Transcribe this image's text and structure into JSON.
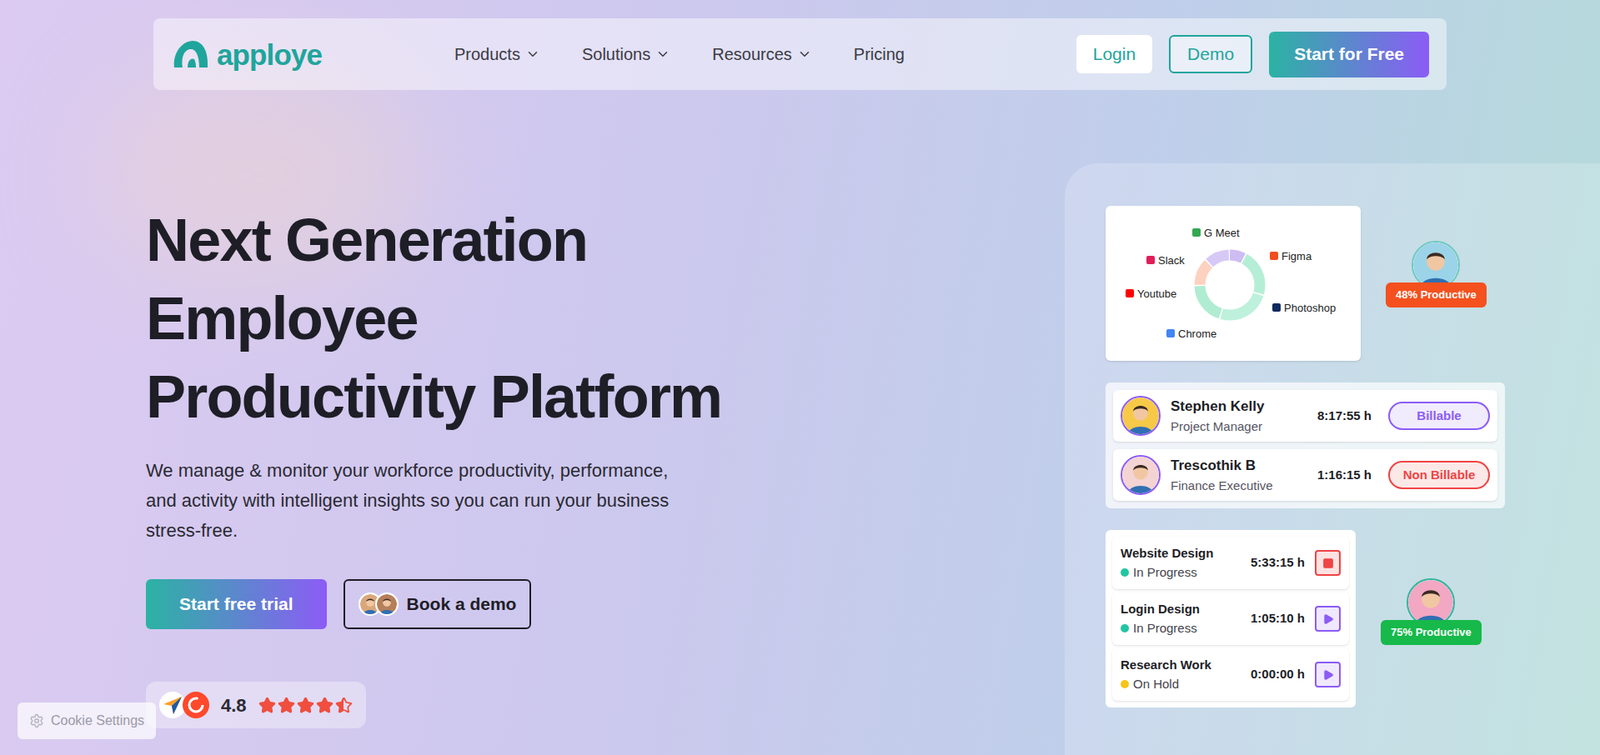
{
  "nav": {
    "logo": "apploye",
    "items": [
      {
        "label": "Products",
        "dropdown": true
      },
      {
        "label": "Solutions",
        "dropdown": true
      },
      {
        "label": "Resources",
        "dropdown": true
      },
      {
        "label": "Pricing",
        "dropdown": false
      }
    ],
    "buttons": [
      {
        "label": "Login",
        "kind": "plain"
      },
      {
        "label": "Demo",
        "kind": "outline"
      },
      {
        "label": "Start for Free",
        "kind": "primary"
      }
    ]
  },
  "hero": {
    "title_lines": [
      "Next Generation",
      "Employee",
      "Productivity Platform"
    ],
    "description": "We manage & monitor your workforce productivity, performance, and activity with intelligent insights so you can run your business stress-free.",
    "buttons": [
      {
        "label": "Start free trial",
        "kind": "primary"
      },
      {
        "label": "Book a demo",
        "kind": "outline"
      }
    ]
  },
  "rating": {
    "score": "4.8",
    "stars": 4.5
  },
  "cookie": {
    "label": "Cookie Settings"
  },
  "app_usage": {
    "segments": [
      {
        "label": "G Meet",
        "value": 8,
        "color": "#cdbdf3"
      },
      {
        "label": "Figma",
        "value": 22,
        "color": "#b5eed6"
      },
      {
        "label": "Photoshop",
        "value": 25,
        "color": "#bdf1db"
      },
      {
        "label": "Chrome",
        "value": 20,
        "color": "#b0ecd2"
      },
      {
        "label": "Youtube",
        "value": 13,
        "color": "#fdd1bf"
      },
      {
        "label": "Slack",
        "value": 12,
        "color": "#d7c9f6"
      }
    ]
  },
  "productivity": [
    {
      "label": "48% Productive",
      "color": "#f4511e"
    },
    {
      "label": "75% Productive",
      "color": "#16b94a"
    }
  ],
  "people": [
    {
      "name": "Stephen Kelly",
      "role": "Project Manager",
      "time": "8:17:55 h",
      "tag": "Billable",
      "color": "#8b5cf6"
    },
    {
      "name": "Trescothik B",
      "role": "Finance Executive",
      "time": "1:16:15 h",
      "tag": "Non Billable",
      "color": "#ef4444"
    }
  ],
  "tasks": [
    {
      "title": "Website Design",
      "status": "In Progress",
      "time": "5:33:15 h",
      "running": true,
      "color": "#22c5a0"
    },
    {
      "title": "Login Design",
      "status": "In Progress",
      "time": "1:05:10 h",
      "running": false,
      "color": "#22c5a0"
    },
    {
      "title": "Research Work",
      "status": "On Hold",
      "time": "0:00:00 h",
      "running": false,
      "color": "#f5c518"
    }
  ]
}
